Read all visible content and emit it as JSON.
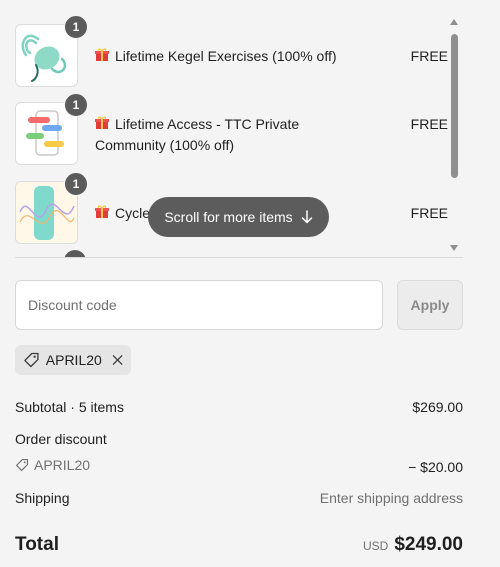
{
  "items": [
    {
      "quantity": "1",
      "title": "Lifetime Kegel Exercises (100% off)",
      "price": "FREE"
    },
    {
      "quantity": "1",
      "title": "Lifetime Access - TTC Private Community (100% off)",
      "price": "FREE"
    },
    {
      "quantity": "1",
      "title": "Cycle",
      "price": "FREE"
    }
  ],
  "scroll_hint": "Scroll for more items",
  "discount": {
    "placeholder": "Discount code",
    "apply_label": "Apply"
  },
  "applied_code": "APRIL20",
  "summary": {
    "subtotal_label": "Subtotal · 5 items",
    "subtotal_value": "$269.00",
    "order_discount_label": "Order discount",
    "discount_code": "APRIL20",
    "discount_value": "− $20.00",
    "shipping_label": "Shipping",
    "shipping_value": "Enter shipping address",
    "total_label": "Total",
    "currency": "USD",
    "total_value": "$249.00"
  },
  "colors": {
    "background": "#f4f4f4",
    "badge": "#5b5b5b",
    "tag_bg": "#e5e5e5"
  }
}
